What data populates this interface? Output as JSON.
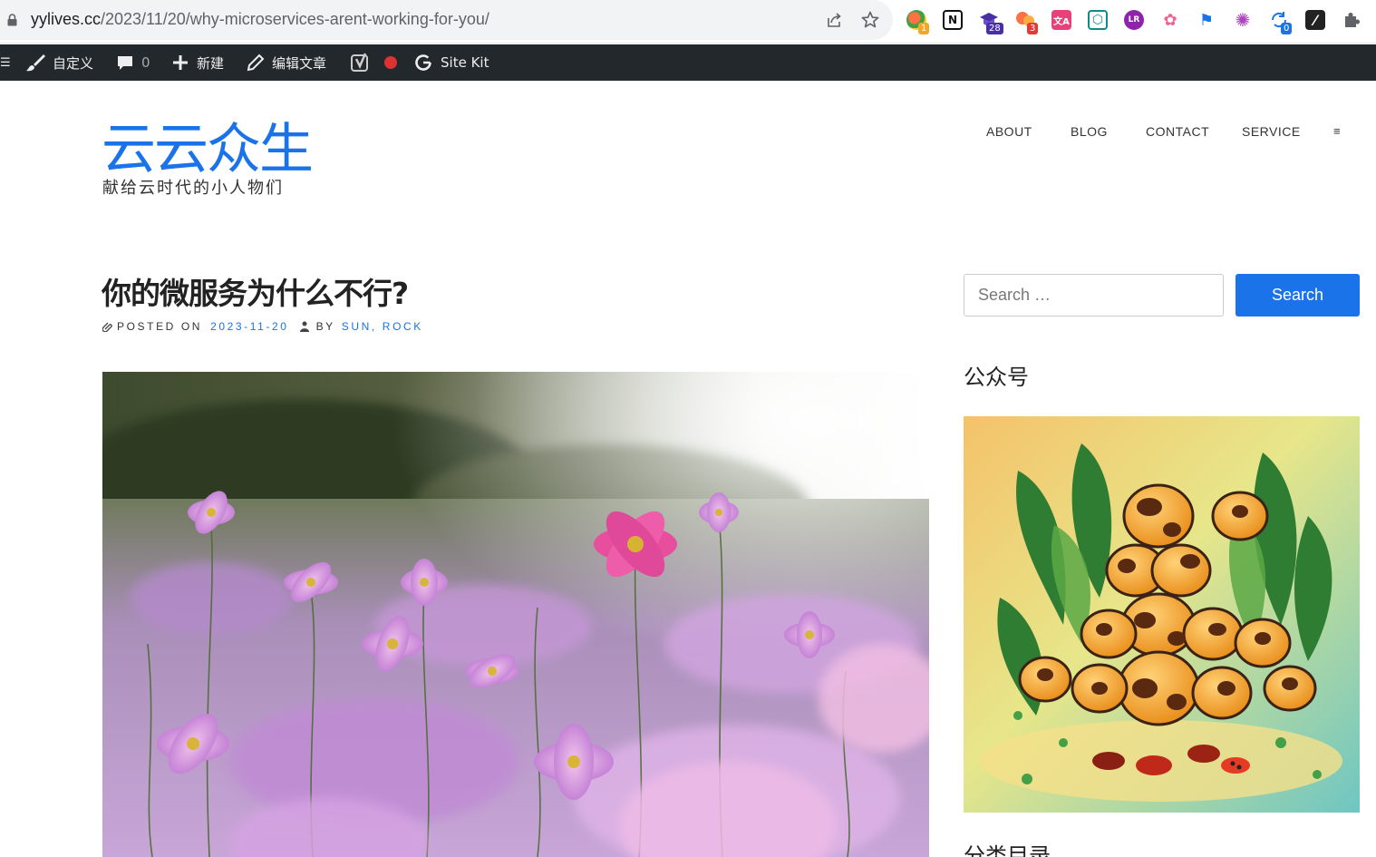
{
  "browser": {
    "url_domain": "yylives.cc",
    "url_path": "/2023/11/20/why-microservices-arent-working-for-you/",
    "extensions": [
      {
        "name": "grammar-extension-icon",
        "badge": "1"
      },
      {
        "name": "notion-icon",
        "glyph": "N"
      },
      {
        "name": "graduation-cap-extension-icon",
        "badge": "28"
      },
      {
        "name": "chat-bubbles-extension-icon",
        "badge": "3"
      },
      {
        "name": "translate-extension-icon",
        "glyph": "文A"
      },
      {
        "name": "network-extension-icon",
        "glyph": "⬡"
      },
      {
        "name": "lr-extension-icon",
        "glyph": "LR"
      },
      {
        "name": "weibo-icon",
        "glyph": "✿"
      },
      {
        "name": "flag-extension-icon",
        "glyph": "⚑"
      },
      {
        "name": "openai-icon",
        "glyph": "✺"
      },
      {
        "name": "sync-extension-icon",
        "badge": "0"
      },
      {
        "name": "slash-extension-icon",
        "glyph": "⁄"
      },
      {
        "name": "extensions-puzzle-icon",
        "glyph": ""
      }
    ]
  },
  "admin_bar": {
    "menu_glyph": "☰",
    "customize": "自定义",
    "comments_count": "0",
    "new": "新建",
    "edit_post": "编辑文章",
    "site_kit": "Site Kit"
  },
  "site": {
    "title": "云云众生",
    "tagline": "献给云时代的小人物们"
  },
  "nav": {
    "items": [
      "ABOUT",
      "BLOG",
      "CONTACT",
      "SERVICE"
    ],
    "menu_glyph": "≡"
  },
  "post": {
    "title": "你的微服务为什么不行?",
    "posted_on_label": "POSTED ON",
    "date": "2023-11-20",
    "by_label": "BY",
    "authors": "SUN, ROCK"
  },
  "sidebar": {
    "search_placeholder": "Search …",
    "search_button": "Search",
    "widget_wechat_title": "公众号",
    "widget_categories_title": "分类目录"
  },
  "colors": {
    "accent": "#1a73e8",
    "admin_bar": "#23282d"
  }
}
